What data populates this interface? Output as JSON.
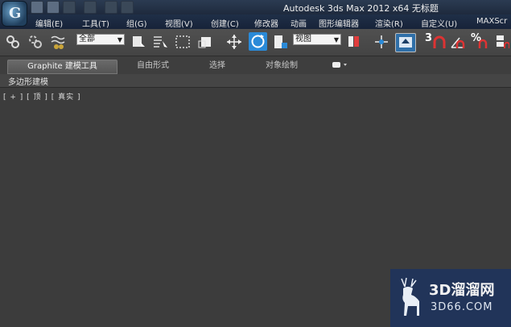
{
  "window": {
    "title": "Autodesk 3ds Max  2012 x64      无标题"
  },
  "menu": {
    "items": [
      "编辑(E)",
      "工具(T)",
      "组(G)",
      "视图(V)",
      "创建(C)",
      "修改器",
      "动画",
      "图形编辑器",
      "渲染(R)",
      "自定义(U)",
      "MAXScr"
    ]
  },
  "toolbar": {
    "selection_filter": "全部",
    "reference_coord": "视图",
    "snap_label": "3",
    "percent_snap_label": "%"
  },
  "ribbon": {
    "tabs": [
      "Graphite 建模工具",
      "自由形式",
      "选择",
      "对象绘制"
    ],
    "active_tab": "Graphite 建模工具",
    "panel_label": "多边形建模"
  },
  "viewport": {
    "label": "[ + ] [ 顶 ] [ 真实 ]"
  },
  "watermark": {
    "brand": "3D溜溜网",
    "url": "3D66.COM"
  },
  "colors": {
    "accent": "#2a8ad8",
    "menubar": "#1f2f47",
    "viewport": "#3c3c3c"
  }
}
